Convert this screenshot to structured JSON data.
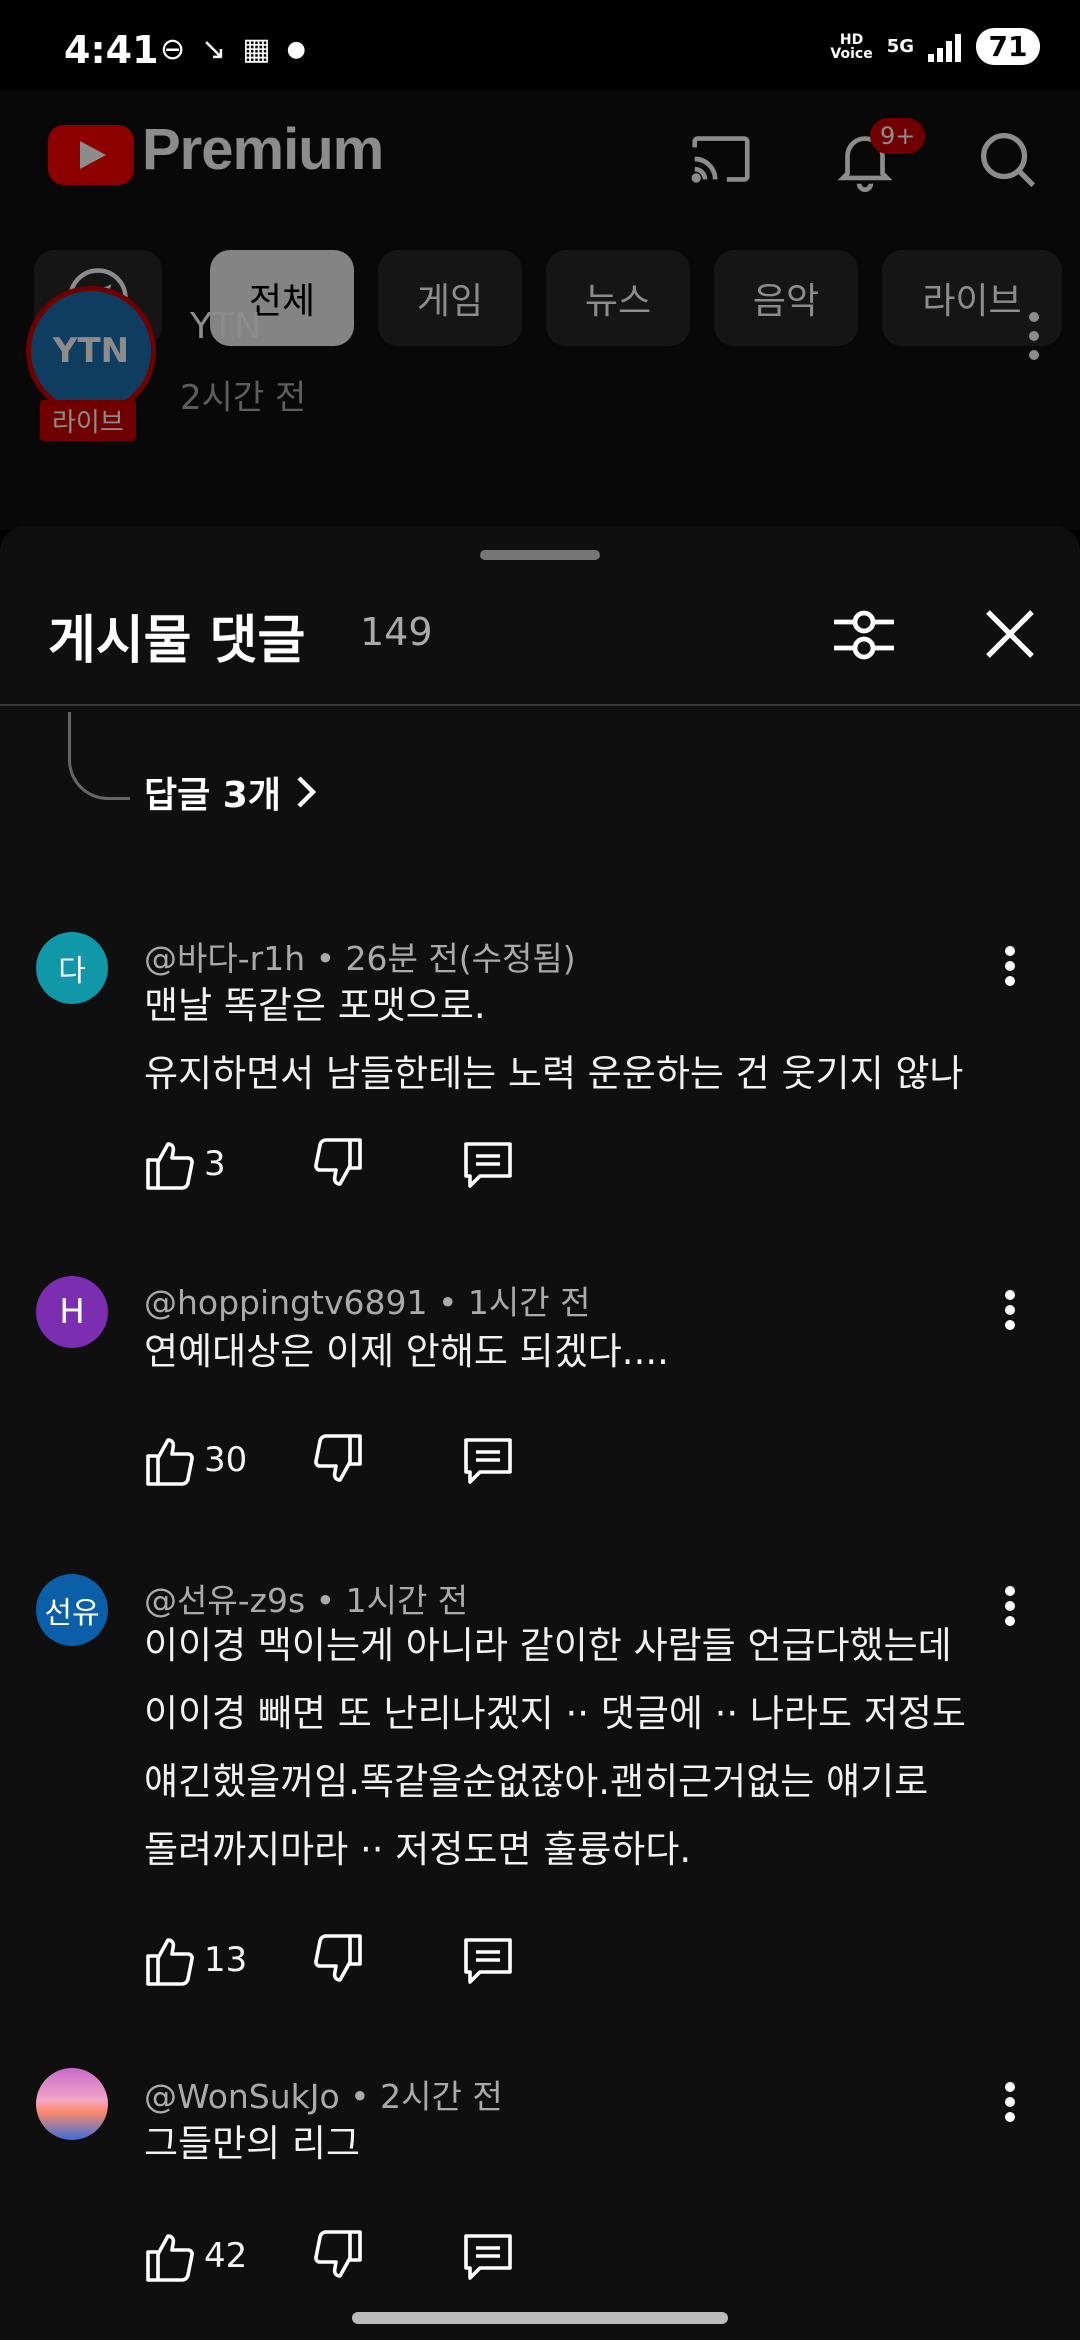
{
  "status_bar": {
    "time": "4:41",
    "hd_voice": "HD\nVoice",
    "network": "5G",
    "battery": "71"
  },
  "header": {
    "brand": "Premium",
    "notification_badge": "9+"
  },
  "chips": [
    "전체",
    "게임",
    "뉴스",
    "음악",
    "라이브"
  ],
  "channel": {
    "avatar_text": "YTN",
    "live_label": "라이브",
    "name": "YTN",
    "time": "2시간 전"
  },
  "sheet": {
    "title": "게시물 댓글",
    "count": "149",
    "replies_link": "답글 3개"
  },
  "comments": [
    {
      "avatar_text": "다",
      "avatar_color": "#1097a8",
      "meta": "@바다-r1h • 26분 전(수정됨)",
      "lines": [
        "맨날 똑같은 포맷으로.",
        "유지하면서 남들한테는 노력 운운하는 건 웃기지 않나"
      ],
      "likes": "3"
    },
    {
      "avatar_text": "H",
      "avatar_color": "#7b2fb0",
      "meta": "@hoppingtv6891 • 1시간 전",
      "lines": [
        "연예대상은 이제 안해도 되겠다...."
      ],
      "likes": "30"
    },
    {
      "avatar_text": "선유",
      "avatar_color": "#0a5fa8",
      "meta": "@선유-z9s • 1시간 전",
      "lines": [
        "이이경 맥이는게 아니라 같이한 사람들 언급다했는데",
        "이이경 빼면 또 난리나겠지 ·· 댓글에 ·· 나라도 저정도",
        "얘긴했을꺼임.똑같을순없잖아.괜히근거없는 얘기로",
        "돌려까지마라 ·· 저정도면 훌륭하다."
      ],
      "likes": "13"
    },
    {
      "avatar_text": "",
      "avatar_color": "#d77fc0",
      "meta": "@WonSukJo • 2시간 전",
      "lines": [
        "그들만의 리그"
      ],
      "likes": "42"
    }
  ],
  "colors": {
    "background": "#0f0f0f",
    "accent_red": "#ff0000",
    "text_primary": "#f1f1f1",
    "text_secondary": "#aaaaaa"
  },
  "icons": [
    "cast-icon",
    "bell-icon",
    "search-icon",
    "compass-icon",
    "filter-icon",
    "close-icon",
    "like-icon",
    "dislike-icon",
    "reply-icon",
    "more-vert-icon",
    "chevron-right-icon"
  ]
}
